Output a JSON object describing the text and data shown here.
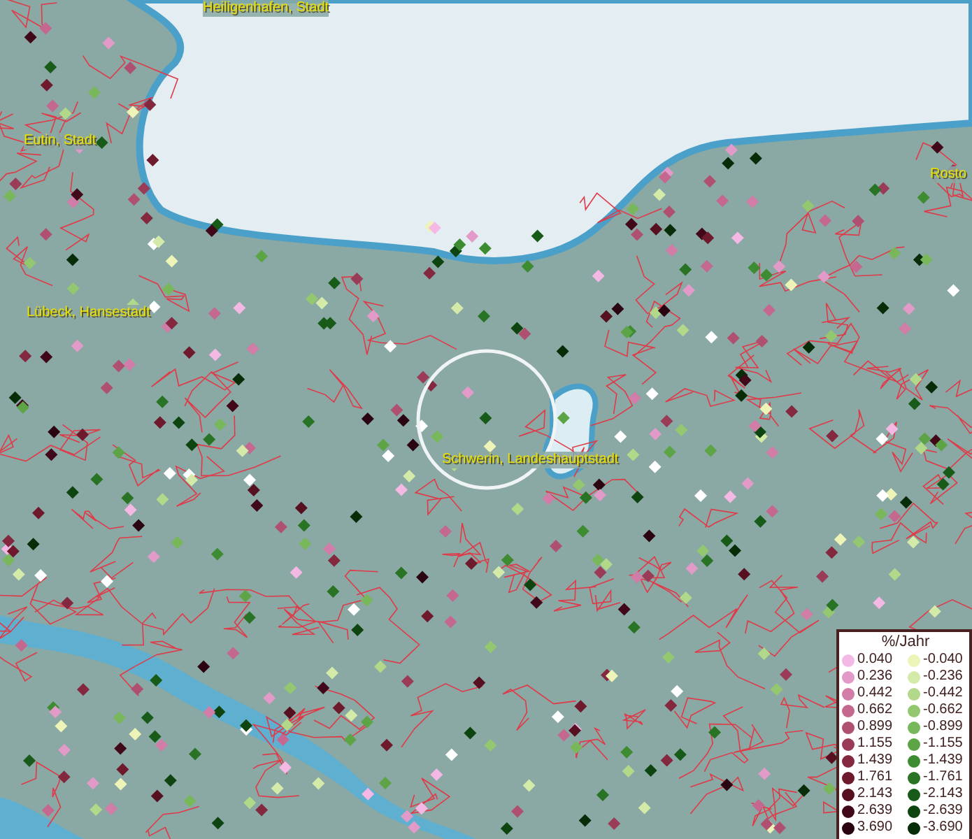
{
  "map": {
    "place_labels": [
      {
        "text": "Heiligenhafen, Stadt"
      },
      {
        "text": "Eutin, Stadt"
      },
      {
        "text": "Rosto"
      },
      {
        "text": "Lübeck, Hansestadt"
      },
      {
        "text": "Schwerin, Landeshauptstadt"
      }
    ]
  },
  "legend": {
    "title": "%/Jahr",
    "positive": [
      {
        "value": "0.040",
        "color": "#f4b8e4"
      },
      {
        "value": "0.236",
        "color": "#e29ac8"
      },
      {
        "value": "0.442",
        "color": "#d27ca8"
      },
      {
        "value": "0.662",
        "color": "#c46890"
      },
      {
        "value": "0.899",
        "color": "#b05070"
      },
      {
        "value": "1.155",
        "color": "#9a3c58"
      },
      {
        "value": "1.439",
        "color": "#84283f"
      },
      {
        "value": "1.761",
        "color": "#6e1a2c"
      },
      {
        "value": "2.143",
        "color": "#561020"
      },
      {
        "value": "2.639",
        "color": "#400818"
      },
      {
        "value": "3.690",
        "color": "#2a0410"
      }
    ],
    "negative": [
      {
        "value": "-0.040",
        "color": "#eef4b8"
      },
      {
        "value": "-0.236",
        "color": "#d4eaa8"
      },
      {
        "value": "-0.442",
        "color": "#b2d88a"
      },
      {
        "value": "-0.662",
        "color": "#94c870"
      },
      {
        "value": "-0.899",
        "color": "#78b85a"
      },
      {
        "value": "-1.155",
        "color": "#5ca446"
      },
      {
        "value": "-1.439",
        "color": "#3e8c32"
      },
      {
        "value": "-1.761",
        "color": "#287424"
      },
      {
        "value": "-2.143",
        "color": "#185a18"
      },
      {
        "value": "-2.639",
        "color": "#0e4410"
      },
      {
        "value": "-3.690",
        "color": "#062c08"
      }
    ]
  }
}
